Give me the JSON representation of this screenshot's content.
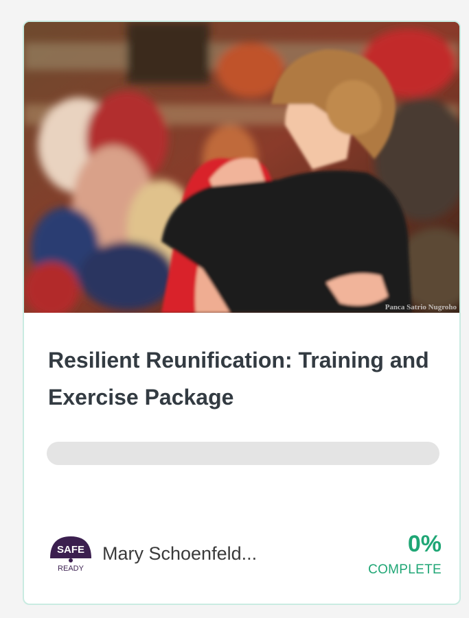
{
  "course": {
    "title": "Resilient Reunification: Training and Exercise Package",
    "image_alt": "Two people embracing in a crowd",
    "image_credit": "Panca Satrio Nugroho",
    "progress_fraction": 0,
    "percent_label": "0%",
    "complete_label": "COMPLETE",
    "author_name": "Mary Schoenfeld...",
    "author_logo": {
      "icon": "safe-ready-logo",
      "top_text": "SAFE",
      "bottom_text": "READY"
    }
  },
  "colors": {
    "accent": "#1fa675",
    "card_border": "#c9ebe1",
    "title_text": "#333b42",
    "progress_track": "#e4e4e4",
    "logo_purple": "#3b1f4f"
  }
}
